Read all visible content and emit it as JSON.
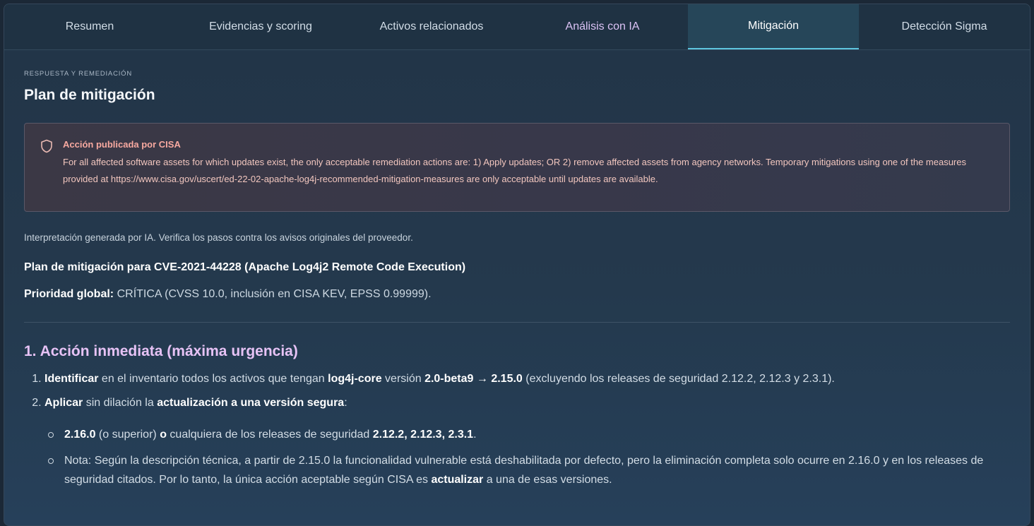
{
  "tabs": [
    {
      "label": "Resumen"
    },
    {
      "label": "Evidencias y scoring"
    },
    {
      "label": "Activos relacionados"
    },
    {
      "label": "Análisis con IA"
    },
    {
      "label": "Mitigación"
    },
    {
      "label": "Detección Sigma"
    }
  ],
  "active_tab": "Mitigación",
  "section": {
    "eyebrow": "RESPUESTA Y REMEDIACIÓN",
    "title": "Plan de mitigación"
  },
  "alert": {
    "icon": "shield-icon",
    "title": "Acción publicada por CISA",
    "body": "For all affected software assets for which updates exist, the only acceptable remediation actions are: 1) Apply updates; OR 2) remove affected assets from agency networks. Temporary mitigations using one of the measures provided at https://www.cisa.gov/uscert/ed-22-02-apache-log4j-recommended-mitigation-measures are only acceptable until updates are available."
  },
  "ai_note": "Interpretación generada por IA. Verifica los pasos contra los avisos originales del proveedor.",
  "plan": {
    "title": "Plan de mitigación para CVE-2021-44228 (Apache Log4j2 Remote Code Execution)",
    "priority_label": "Prioridad global:",
    "priority_value": "CRÍTICA (CVSS 10.0, inclusión en CISA KEV, EPSS 0.99999)."
  },
  "immediate": {
    "heading": "1. Acción inmediata (máxima urgencia)",
    "step1": {
      "b1": "Identificar",
      "t1": " en el inventario todos los activos que tengan ",
      "b2": "log4j-core",
      "t2": " versión ",
      "b3": "2.0-beta9 → 2.15.0",
      "t3": " (excluyendo los releases de seguridad 2.12.2, 2.12.3 y 2.3.1)."
    },
    "step2": {
      "b1": "Aplicar",
      "t1": " sin dilación la ",
      "b2": "actualización a una versión segura",
      "t2": ":"
    },
    "sub1": {
      "b1": "2.16.0",
      "t1": " (o superior) ",
      "b2": "o",
      "t2": " cualquiera de los releases de seguridad ",
      "b3": "2.12.2, 2.12.3, 2.3.1",
      "t3": "."
    },
    "sub2": {
      "t1": "Nota: Según la descripción técnica, a partir de 2.15.0 la funcionalidad vulnerable está deshabilitada por defecto, pero la eliminación completa solo ocurre en 2.16.0 y en los releases de seguridad citados. Por lo tanto, la única acción aceptable según CISA es ",
      "b1": "actualizar",
      "t2": " a una de esas versiones."
    }
  },
  "colors": {
    "background": "#1b2836",
    "active_tab_underline": "#5ec7e0",
    "ai_accent": "#e6c2f5",
    "alert_title": "#f7a9a0"
  }
}
